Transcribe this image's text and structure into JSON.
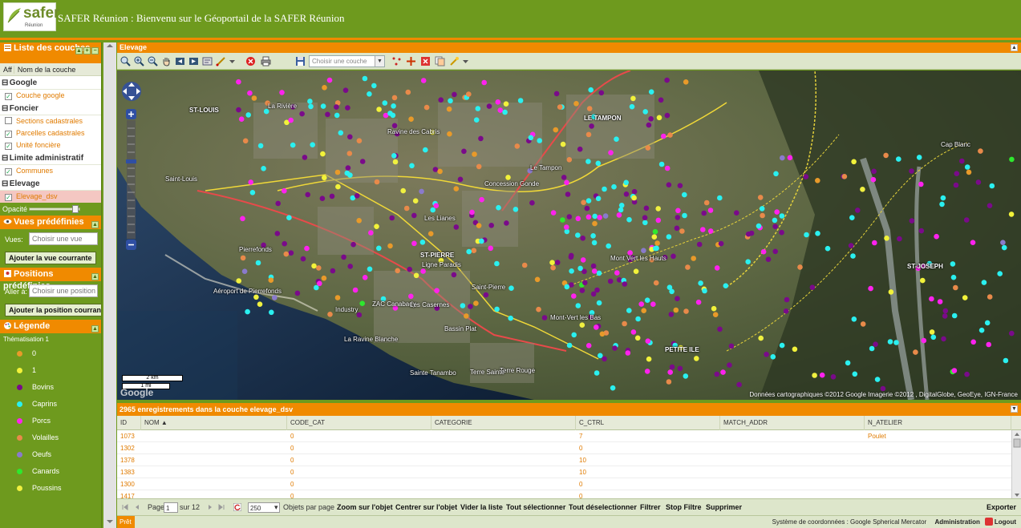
{
  "app": {
    "logo_text": "safer",
    "logo_sub": "Réunion",
    "title": "SAFER Réunion : Bienvenu sur le Géoportail de la SAFER Réunion"
  },
  "layers_panel": {
    "title": "Liste des couches",
    "col_aff": "Aff",
    "col_name": "Nom de la couche",
    "groups": [
      {
        "name": "Google",
        "layers": [
          {
            "name": "Couche google",
            "checked": true,
            "active": false
          }
        ]
      },
      {
        "name": "Foncier",
        "layers": [
          {
            "name": "Sections cadastrales",
            "checked": false,
            "active": false
          },
          {
            "name": "Parcelles cadastrales",
            "checked": true,
            "active": false
          },
          {
            "name": "Unité foncière",
            "checked": true,
            "active": false
          }
        ]
      },
      {
        "name": "Limite administratif",
        "layers": [
          {
            "name": "Communes",
            "checked": true,
            "active": false
          }
        ]
      },
      {
        "name": "Elevage",
        "layers": [
          {
            "name": "Elevage_dsv",
            "checked": true,
            "active": true
          }
        ]
      }
    ],
    "opacity_label": "Opacité",
    "opacity_value": 0.9
  },
  "vues": {
    "title": "Vues prédéfinies",
    "label": "Vues:",
    "placeholder": "Choisir une vue",
    "button": "Ajouter la vue courrante"
  },
  "positions": {
    "title": "Positions prédéfinies",
    "label": "Aller à:",
    "placeholder": "Choisir une position",
    "button": "Ajouter la position courrante"
  },
  "legend": {
    "title": "Légende",
    "subtitle": "Thématisation 1",
    "items": [
      {
        "label": "0",
        "color": "#e89a2a"
      },
      {
        "label": "1",
        "color": "#f2f23a"
      },
      {
        "label": "Bovins",
        "color": "#7a0a8a"
      },
      {
        "label": "Caprins",
        "color": "#2af0f0"
      },
      {
        "label": "Porcs",
        "color": "#ff22ee"
      },
      {
        "label": "Volailles",
        "color": "#e88a4a"
      },
      {
        "label": "Oeufs",
        "color": "#8a7acc"
      },
      {
        "label": "Canards",
        "color": "#2ee82e"
      },
      {
        "label": "Poussins",
        "color": "#f0f040"
      }
    ]
  },
  "map": {
    "title": "Elevage",
    "couche_select": "Choisir une couche",
    "places": [
      {
        "label": "ST-LOUIS",
        "big": true
      },
      {
        "label": "LE TAMPON",
        "big": true
      },
      {
        "label": "ST-PIERRE",
        "big": true
      },
      {
        "label": "ST-JOSEPH",
        "big": true
      },
      {
        "label": "PETITE ILE",
        "big": true
      },
      {
        "label": "Cap Blanc",
        "big": false
      },
      {
        "label": "Saint-Louis",
        "big": false
      },
      {
        "label": "Le Tampon",
        "big": false
      },
      {
        "label": "Concession Gonde",
        "big": false
      },
      {
        "label": "La Rivière",
        "big": false
      },
      {
        "label": "Ravine des Cabris",
        "big": false
      },
      {
        "label": "Pierrefonds",
        "big": false
      },
      {
        "label": "Aéroport de Pierrefonds",
        "big": false
      },
      {
        "label": "Ligne Paradis",
        "big": false
      },
      {
        "label": "Saint-Pierre",
        "big": false
      },
      {
        "label": "Industry",
        "big": false
      },
      {
        "label": "ZAC Canabady",
        "big": false
      },
      {
        "label": "Bassin Plat",
        "big": false
      },
      {
        "label": "La Ravine Blanche",
        "big": false
      },
      {
        "label": "Mont-Vert les Bas",
        "big": false
      },
      {
        "label": "Mont Vert les Hauts",
        "big": false
      },
      {
        "label": "Terre Rouge",
        "big": false
      },
      {
        "label": "Sainte Tanambo",
        "big": false
      },
      {
        "label": "Les Casernes",
        "big": false
      },
      {
        "label": "Terre Sainte",
        "big": false
      },
      {
        "label": "Les Lianes",
        "big": false
      }
    ],
    "scale_km": "2 km",
    "scale_mi": "1 mi",
    "attribution": "Données cartographiques ©2012 Google Imagerie ©2012 , DigitalGlobe, GeoEye, IGN-France",
    "google": "Google"
  },
  "grid": {
    "title": "2965 enregistrements dans la couche elevage_dsv",
    "columns": [
      "ID",
      "NOM ▲",
      "CODE_CAT",
      "CATEGORIE",
      "C_CTRL",
      "MATCH_ADDR",
      "N_ATELIER"
    ],
    "rows": [
      [
        "1073",
        "",
        "0",
        "",
        "7",
        "",
        "Poulet"
      ],
      [
        "1302",
        "",
        "0",
        "",
        "0",
        "",
        ""
      ],
      [
        "1378",
        "",
        "0",
        "",
        "10",
        "",
        ""
      ],
      [
        "1383",
        "",
        "0",
        "",
        "10",
        "",
        ""
      ],
      [
        "1300",
        "",
        "0",
        "",
        "0",
        "",
        ""
      ],
      [
        "1417",
        "",
        "0",
        "",
        "0",
        "",
        ""
      ]
    ]
  },
  "pager": {
    "page_label": "Page",
    "page_value": "1",
    "of_label": "sur 12",
    "per_page_value": "250",
    "per_page_label": "Objets par page",
    "actions": [
      "Zoom sur l'objet",
      "Centrer sur l'objet",
      "Vider la liste",
      "Tout sélectionner",
      "Tout déselectionner",
      "Filtrer",
      "Stop Filtre",
      "Supprimer"
    ],
    "export": "Exporter"
  },
  "status": {
    "ready": "Prêt",
    "coords": "Système de coordonnées : Google Spherical Mercator",
    "admin": "Administration",
    "logout": "Logout"
  }
}
